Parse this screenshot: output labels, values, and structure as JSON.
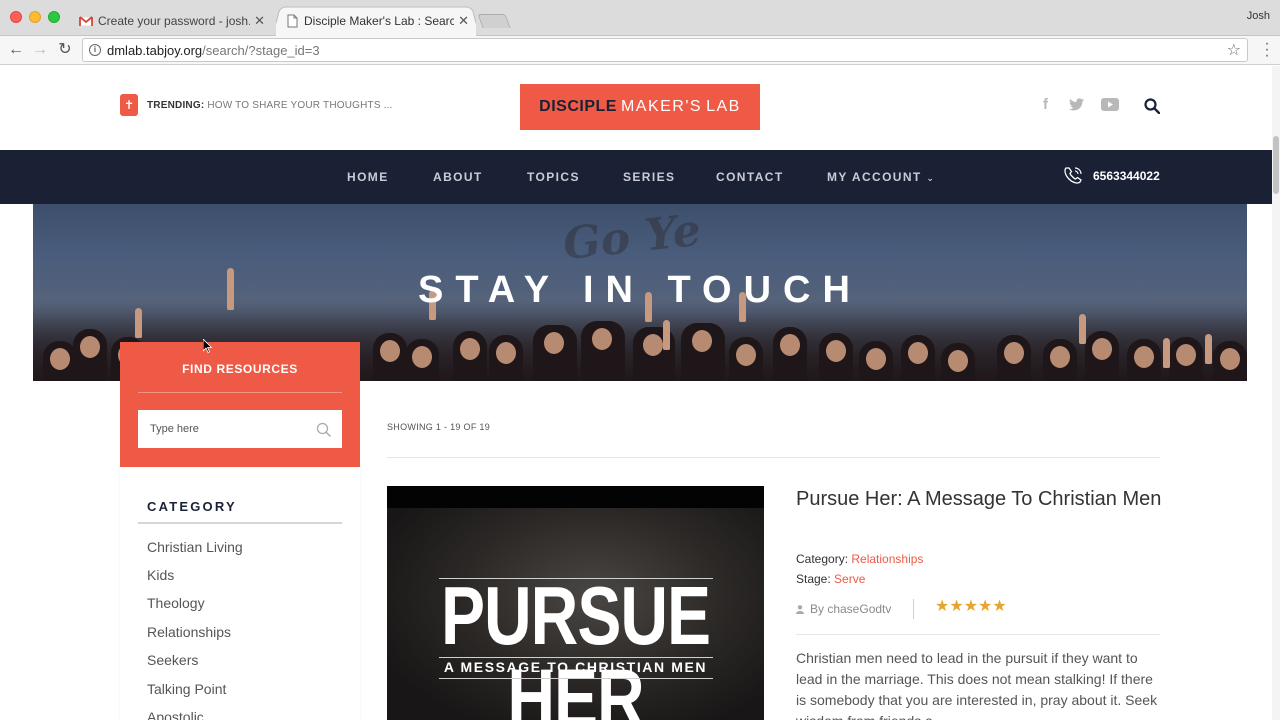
{
  "browser": {
    "tabs": [
      {
        "title": "Create your password - josh.li",
        "active": false
      },
      {
        "title": "Disciple Maker's Lab : Search",
        "active": true
      }
    ],
    "user": "Josh",
    "url_host": "dmlab.tabjoy.org",
    "url_path": "/search/?stage_id=3"
  },
  "header": {
    "trending_label": "TRENDING:",
    "trending_text": "HOW TO SHARE YOUR THOUGHTS ...",
    "logo_part1": "DISCIPLE",
    "logo_part2": "MAKER'S",
    "logo_part3": "LAB",
    "social_icons": [
      "facebook-icon",
      "twitter-icon",
      "youtube-icon"
    ]
  },
  "nav": {
    "items": [
      "HOME",
      "ABOUT",
      "TOPICS",
      "SERIES",
      "CONTACT",
      "MY ACCOUNT"
    ],
    "phone": "6563344022"
  },
  "hero": {
    "title": "STAY IN TOUCH",
    "watermark": "Go Ye"
  },
  "sidebar": {
    "title": "FIND RESOURCES",
    "search_placeholder": "Type here",
    "category_title": "CATEGORY",
    "categories": [
      "Christian Living",
      "Kids",
      "Theology",
      "Relationships",
      "Seekers",
      "Talking Point",
      "Apostolic"
    ]
  },
  "results": {
    "showing": "SHOWING 1 - 19 OF 19",
    "post": {
      "thumb_title": "PURSUE HER",
      "thumb_subtitle": "A MESSAGE TO CHRISTIAN MEN",
      "title": "Pursue Her: A Message To Christian Men",
      "category_label": "Category:",
      "category_value": "Relationships",
      "stage_label": "Stage:",
      "stage_value": "Serve",
      "author": "By chaseGodtv",
      "stars": "★★★★★",
      "rating": 5,
      "excerpt": "Christian men need to lead in the pursuit if they want to lead in the marriage. This does not mean stalking! If there is somebody that you are interested in, pray about it. Seek wisdom from friends a..."
    }
  },
  "colors": {
    "accent": "#ee5a45",
    "navy": "#1b2135",
    "star": "#e8a52d"
  }
}
